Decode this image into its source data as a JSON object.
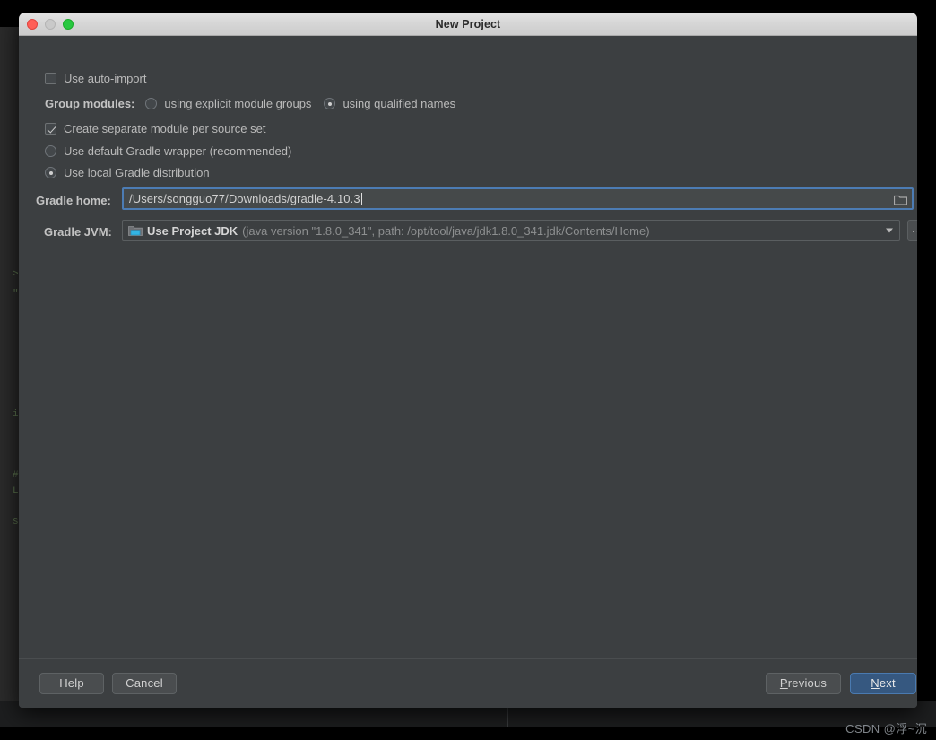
{
  "window": {
    "title": "New Project",
    "traffic_lights": [
      "close-button",
      "minimize-button",
      "zoom-button"
    ]
  },
  "form": {
    "auto_import": {
      "label": "Use auto-import",
      "checked": false
    },
    "group_modules": {
      "label": "Group modules:",
      "options": [
        {
          "label": "using explicit module groups",
          "selected": false
        },
        {
          "label": "using qualified names",
          "selected": true
        }
      ]
    },
    "separate_module": {
      "label": "Create separate module per source set",
      "checked": true
    },
    "gradle_distribution": {
      "options": [
        {
          "label": "Use default Gradle wrapper (recommended)",
          "selected": false
        },
        {
          "label": "Use local Gradle distribution",
          "selected": true
        }
      ]
    },
    "gradle_home": {
      "label": "Gradle home:",
      "value": "/Users/songguo77/Downloads/gradle-4.10.3",
      "placeholder": "",
      "browse_icon": "folder-icon"
    },
    "gradle_jvm": {
      "label": "Gradle JVM:",
      "icon": "jdk-folder-icon",
      "value_main": "Use Project JDK",
      "value_detail": "(java version \"1.8.0_341\", path: /opt/tool/java/jdk1.8.0_341.jdk/Contents/Home)",
      "dropdown_icon": "chevron-down-icon",
      "browse_button": "..."
    }
  },
  "footer": {
    "help": "Help",
    "cancel": "Cancel",
    "previous": {
      "mnemonic": "P",
      "rest": "revious"
    },
    "next": {
      "mnemonic": "N",
      "rest": "ext"
    }
  },
  "watermark": "CSDN @浮~沉",
  "colors": {
    "dialog_bg": "#3c3f41",
    "titlebar": "#d6d6d6",
    "focus_border": "#4c7cb4",
    "primary_button": "#365880",
    "text": "#bbbbbb",
    "muted_text": "#8d8f90"
  },
  "background": {
    "code_fragments": [
      ">",
      "\"",
      "i",
      "#",
      "L",
      "s"
    ]
  }
}
